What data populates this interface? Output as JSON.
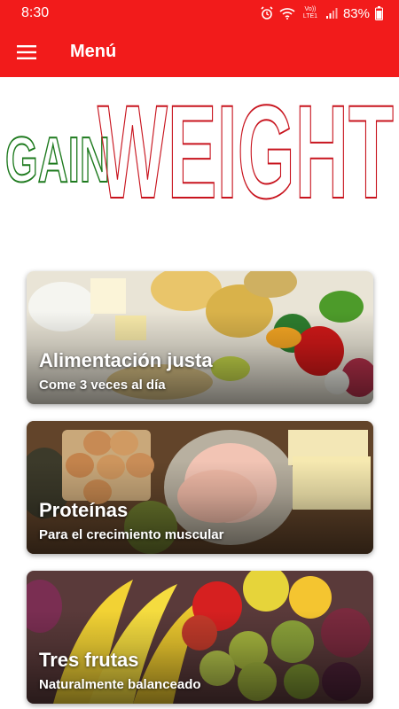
{
  "status_bar": {
    "time": "8:30",
    "battery": "83%",
    "network": "Vo)) LTE1",
    "icons": [
      "alarm-icon",
      "wifi-icon",
      "signal-icon",
      "battery-icon"
    ]
  },
  "app_bar": {
    "title": "Menú",
    "menu_icon": "hamburger-icon",
    "color": "#f21b1b"
  },
  "logo": {
    "word1": "GAIN",
    "word2": "WEIGHT",
    "word1_color": "#1e7a1e",
    "word2_color": "#c8141e"
  },
  "cards": [
    {
      "title": "Alimentación justa",
      "subtitle": "Come 3 veces al día"
    },
    {
      "title": "Proteínas",
      "subtitle": "Para el crecimiento muscular"
    },
    {
      "title": "Tres frutas",
      "subtitle": "Naturalmente balanceado"
    }
  ]
}
